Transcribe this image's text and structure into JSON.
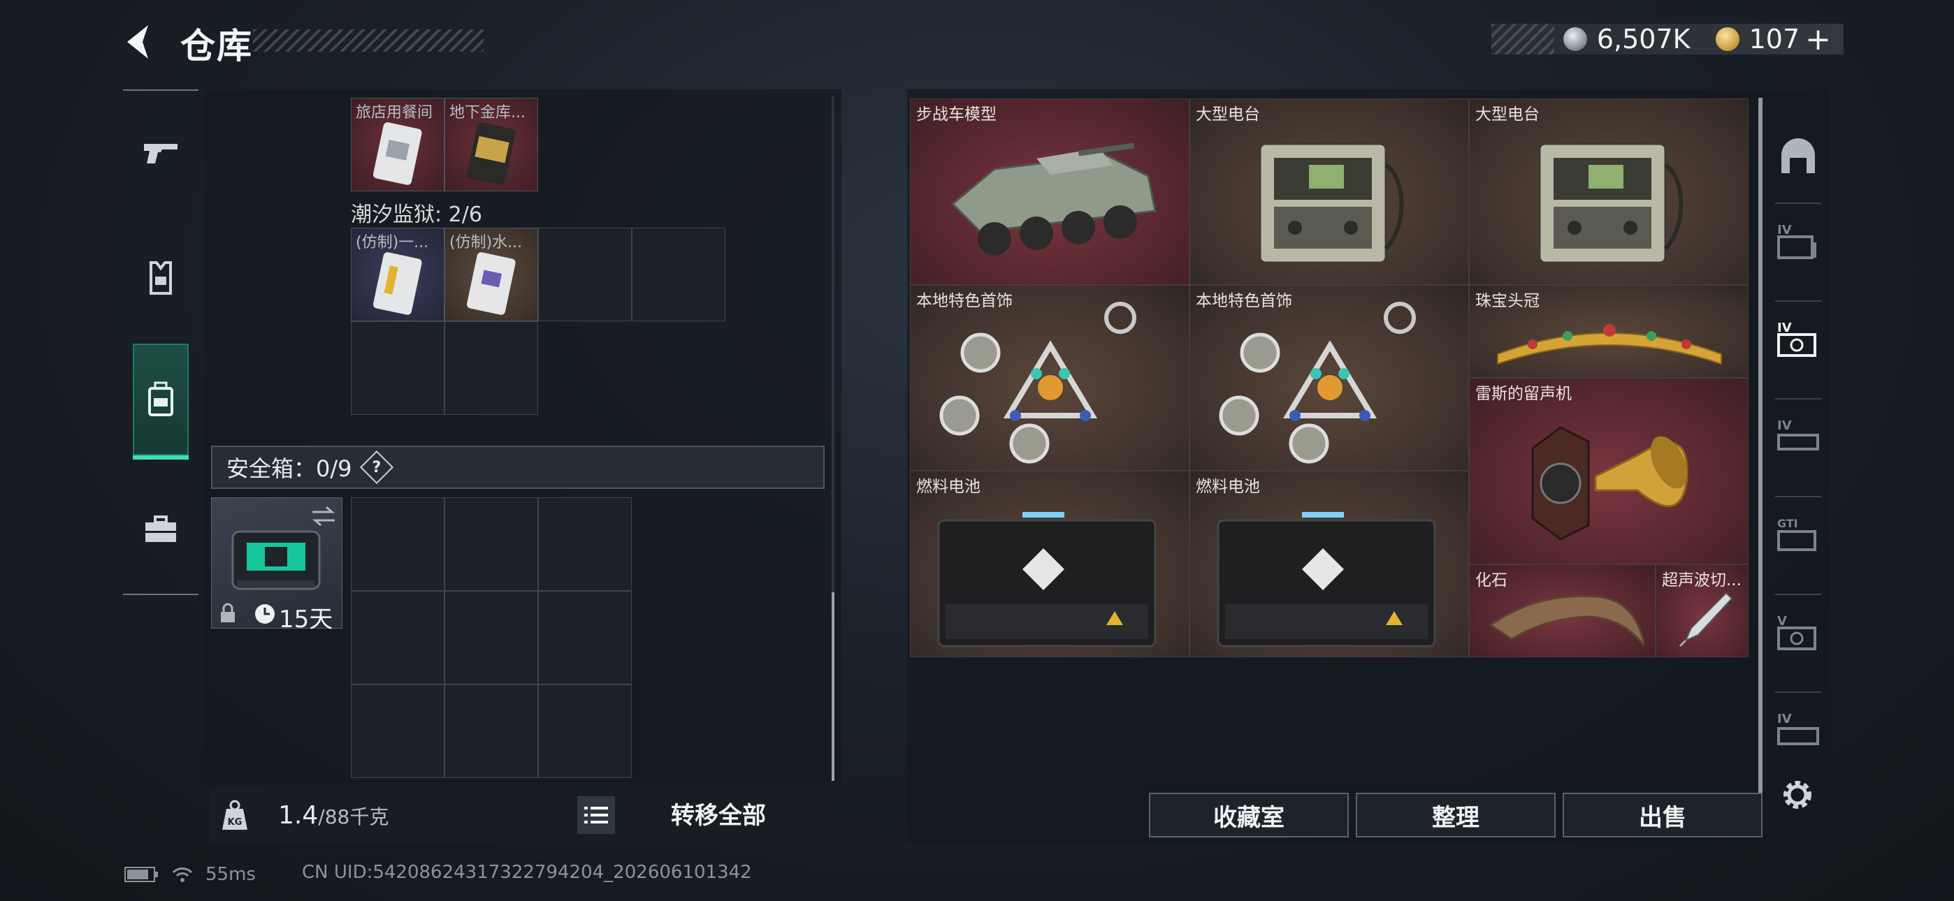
{
  "header": {
    "title": "仓库",
    "currency_silver": "6,507K",
    "currency_gold": "107",
    "plus_label": "+"
  },
  "left_nav": {
    "items": [
      {
        "name": "weapon",
        "icon": "pistol-icon"
      },
      {
        "name": "gear",
        "icon": "vest-icon"
      },
      {
        "name": "backpack",
        "icon": "backpack-icon",
        "active": true
      },
      {
        "name": "case",
        "icon": "briefcase-icon"
      }
    ]
  },
  "container": {
    "key_labels": [
      "旅店用餐间",
      "地下金库..."
    ],
    "prison_title": "潮汐监狱: 2/6",
    "prison_labels": [
      "(仿制)一...",
      "(仿制)水..."
    ]
  },
  "safe": {
    "label": "安全箱：0/9",
    "help": "?",
    "days": "15天"
  },
  "footer_left": {
    "weight": "1.4",
    "weight_max": "/88千克",
    "weight_icon_text": "KG",
    "transfer_all": "转移全部"
  },
  "stash": {
    "items": [
      {
        "label": "步战车模型",
        "bg": "red"
      },
      {
        "label": "大型电台",
        "bg": "brown"
      },
      {
        "label": "大型电台",
        "bg": "brown"
      },
      {
        "label": "本地特色首饰",
        "bg": "brown"
      },
      {
        "label": "本地特色首饰",
        "bg": "brown"
      },
      {
        "label": "珠宝头冠",
        "bg": "brown"
      },
      {
        "label": "雷斯的留声机",
        "bg": "red"
      },
      {
        "label": "燃料电池",
        "bg": "brown"
      },
      {
        "label": "燃料电池",
        "bg": "brown"
      },
      {
        "label": "化石",
        "bg": "red"
      },
      {
        "label": "超声波切...",
        "bg": "red"
      }
    ]
  },
  "right_tabs": [
    "bunker-icon",
    "IV",
    "IV",
    "IV",
    "GTI",
    "V",
    "IV"
  ],
  "actions": {
    "collection": "收藏室",
    "sort": "整理",
    "sell": "出售"
  },
  "status": {
    "ping": "55ms",
    "uid": "CN UID:542086243173227942​04_202606101342"
  },
  "colors": {
    "accent": "#3ee0b0",
    "item_red": "#5a2a31",
    "item_brown": "#3e322c"
  }
}
